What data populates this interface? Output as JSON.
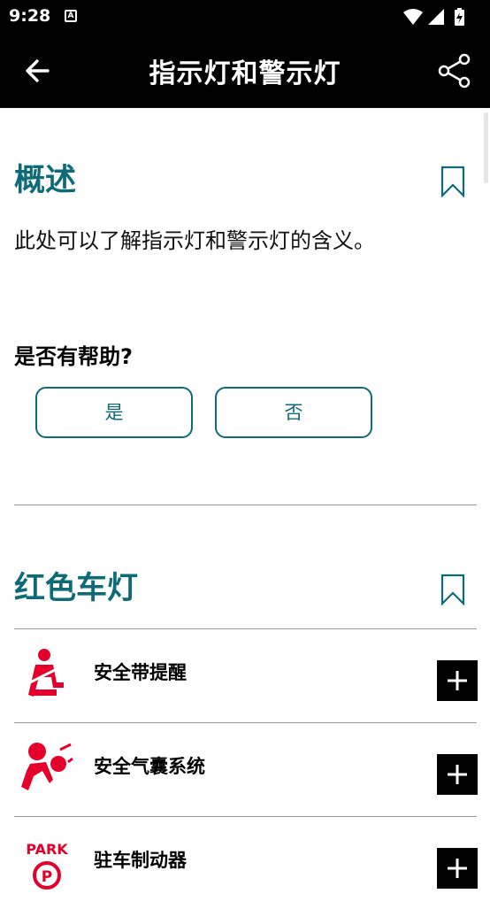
{
  "status_bar": {
    "time": "9:28",
    "notification_letter": "A"
  },
  "app_bar": {
    "title": "指示灯和警示灯"
  },
  "overview": {
    "title": "概述",
    "description": "此处可以了解指示灯和警示灯的含义。"
  },
  "feedback": {
    "question": "是否有帮助?",
    "yes_label": "是",
    "no_label": "否"
  },
  "red_lights": {
    "title": "红色车灯",
    "items": [
      {
        "label": "安全带提醒",
        "icon": "seatbelt-warning-icon"
      },
      {
        "label": "安全气囊系统",
        "icon": "airbag-warning-icon"
      },
      {
        "label": "驻车制动器",
        "icon": "parking-brake-icon",
        "icon_text": "PARK"
      }
    ]
  },
  "colors": {
    "accent": "#0d6b77",
    "warning_red": "#e4002b",
    "bar": "#000000"
  }
}
